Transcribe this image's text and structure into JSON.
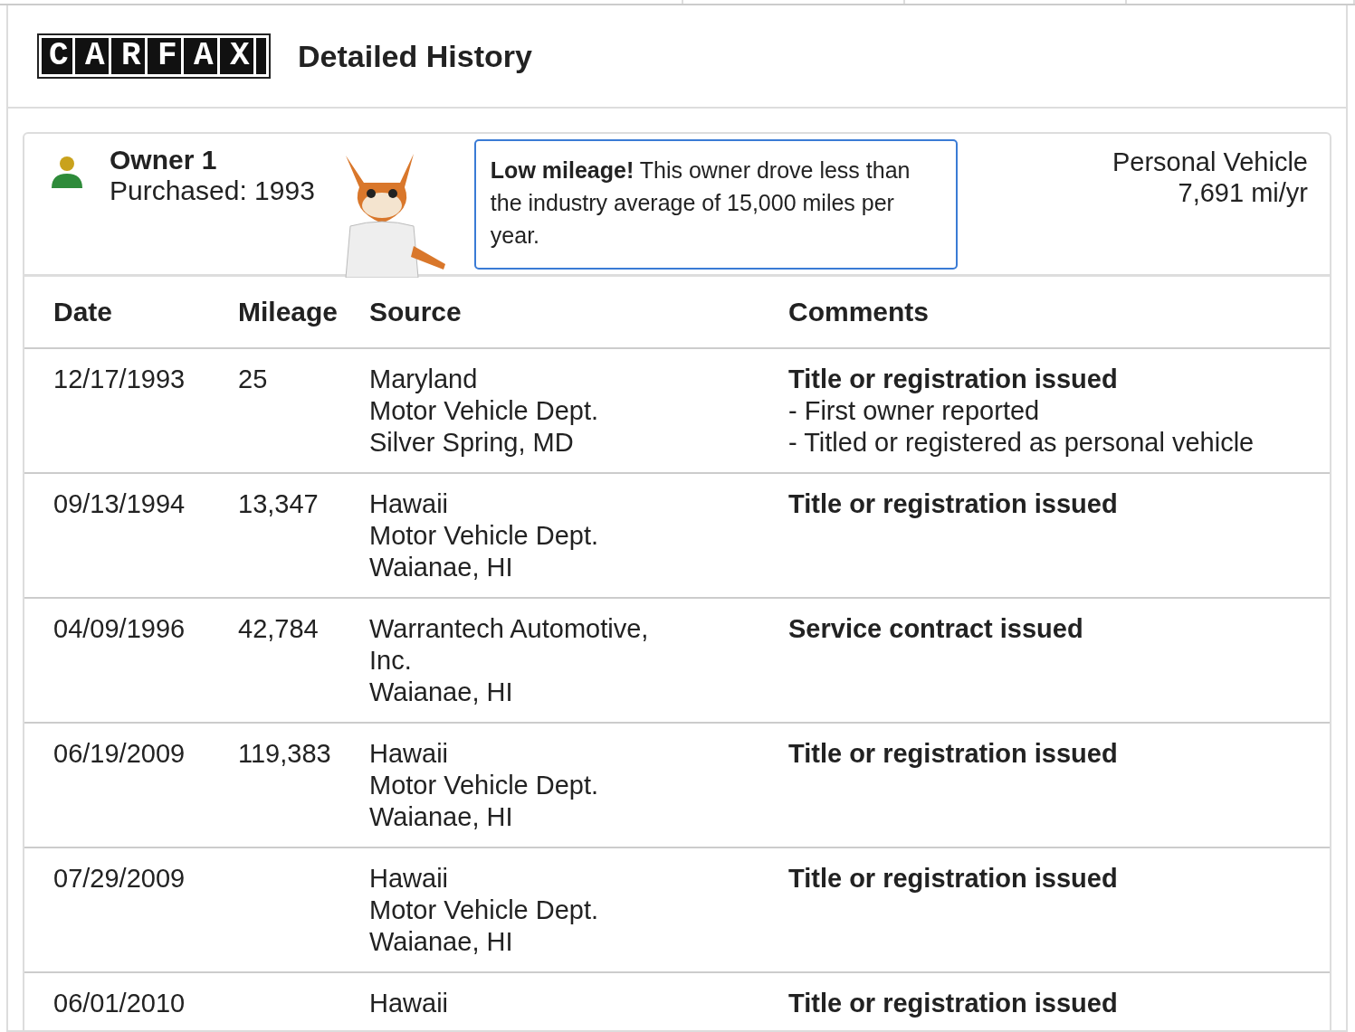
{
  "logo": "CARFAX",
  "title": "Detailed History",
  "owner": {
    "name": "Owner 1",
    "purchased": "Purchased: 1993",
    "note_bold": "Low mileage!",
    "note": "This owner drove less than the industry average of 15,000 miles per year.",
    "usage": "Personal Vehicle",
    "rate": "7,691 mi/yr"
  },
  "table": {
    "columns": [
      "Date",
      "Mileage",
      "Source",
      "Comments"
    ],
    "rows": [
      {
        "date": "12/17/1993",
        "mileage": "25",
        "source": [
          "Maryland",
          "Motor Vehicle Dept.",
          "Silver Spring, MD"
        ],
        "comment": "Title or registration issued",
        "details": [
          "- First owner reported",
          "- Titled or registered as personal vehicle"
        ]
      },
      {
        "date": "09/13/1994",
        "mileage": "13,347",
        "source": [
          "Hawaii",
          "Motor Vehicle Dept.",
          "Waianae, HI"
        ],
        "comment": "Title or registration issued"
      },
      {
        "date": "04/09/1996",
        "mileage": "42,784",
        "source": [
          "Warrantech Automotive,",
          "Inc.",
          "Waianae, HI"
        ],
        "comment": "Service contract issued"
      },
      {
        "date": "06/19/2009",
        "mileage": "119,383",
        "source": [
          "Hawaii",
          "Motor Vehicle Dept.",
          "Waianae, HI"
        ],
        "comment": "Title or registration issued"
      },
      {
        "date": "07/29/2009",
        "source": [
          "Hawaii",
          "Motor Vehicle Dept.",
          "Waianae, HI"
        ],
        "comment": "Title or registration issued"
      },
      {
        "date": "06/01/2010",
        "source": [
          "Hawaii"
        ],
        "comment": "Title or registration issued"
      }
    ]
  }
}
